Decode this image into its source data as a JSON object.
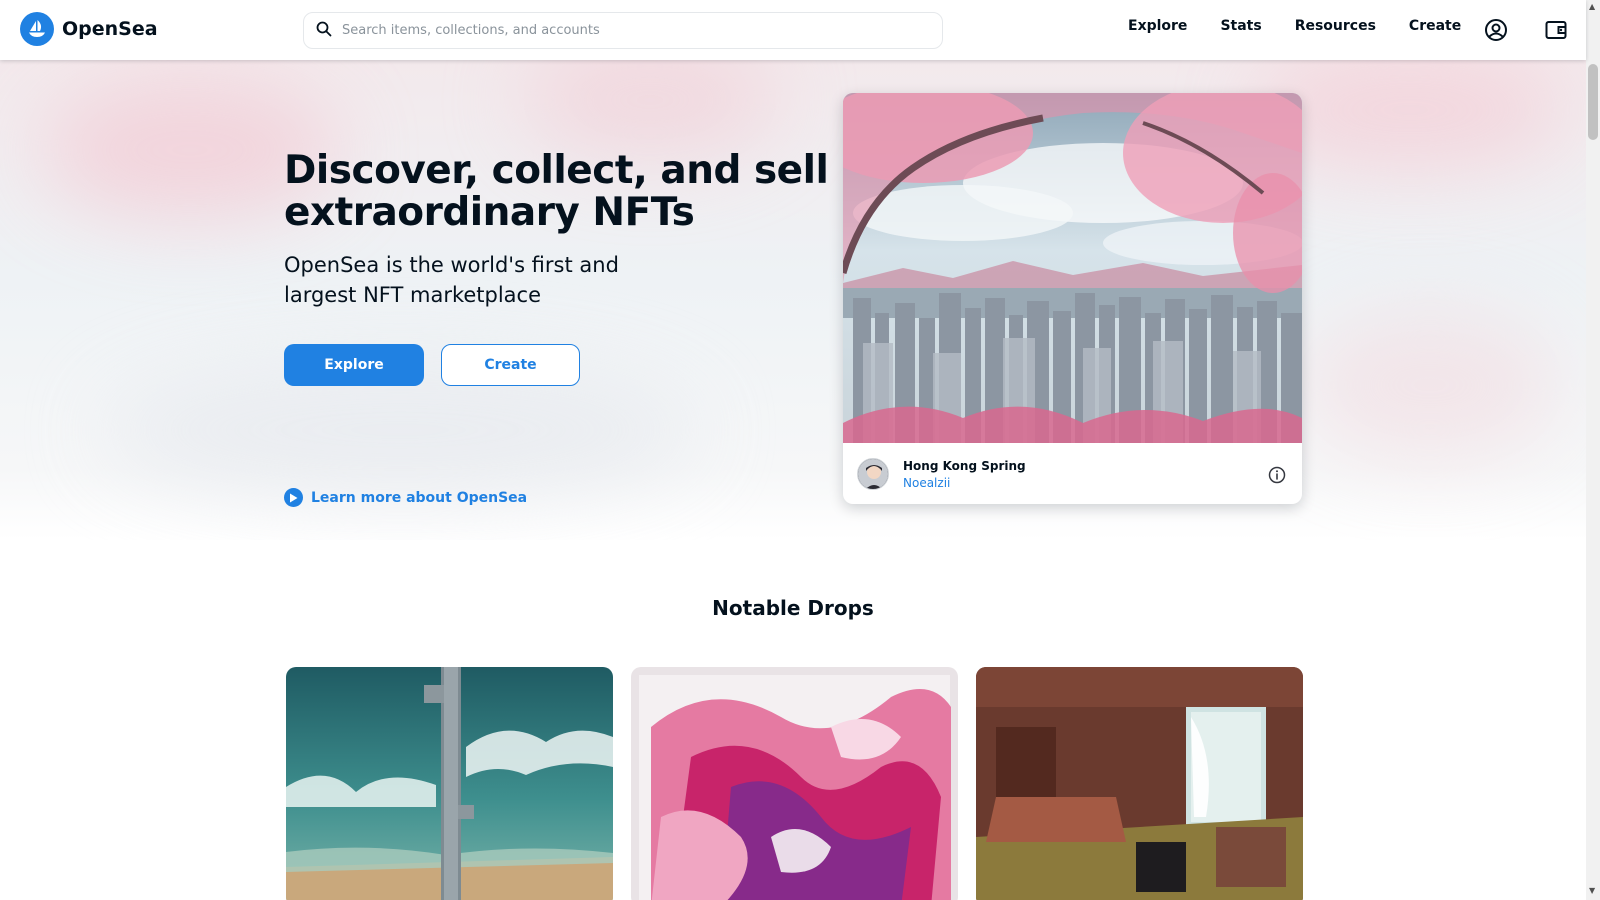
{
  "header": {
    "logo_text": "OpenSea",
    "search_placeholder": "Search items, collections, and accounts",
    "nav": [
      "Explore",
      "Stats",
      "Resources",
      "Create"
    ],
    "icons": [
      "account-icon",
      "wallet-icon"
    ]
  },
  "hero": {
    "title_line1": "Discover, collect, and sell",
    "title_line2": "extraordinary NFTs",
    "subtitle_line1": "OpenSea is the world's first and",
    "subtitle_line2": "largest NFT marketplace",
    "explore_label": "Explore",
    "create_label": "Create",
    "learn_label": "Learn more about OpenSea"
  },
  "featured": {
    "title": "Hong Kong Spring",
    "creator": "Noealzii"
  },
  "notable": {
    "title": "Notable Drops",
    "items": [
      "aerial-ocean-pier",
      "pink-abstract-flowers",
      "vintage-bedroom"
    ]
  },
  "colors": {
    "accent": "#2081e2",
    "text": "#04111d",
    "muted": "#8a939b"
  }
}
